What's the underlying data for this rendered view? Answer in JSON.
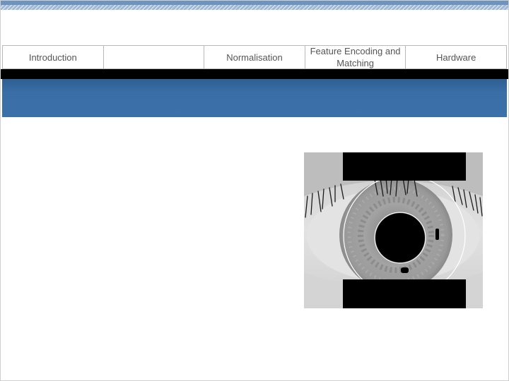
{
  "nav": {
    "items": [
      {
        "label": "Introduction"
      },
      {
        "label": ""
      },
      {
        "label": "Normalisation"
      },
      {
        "label": "Feature Encoding and Matching"
      },
      {
        "label": "Hardware"
      }
    ]
  },
  "figure": {
    "icon": "segmented-iris-eye-image",
    "colors": {
      "mask": "#000000",
      "boundary": "#ffffff",
      "sclera": "#d9d9d9",
      "iris": "#9c9c9c"
    }
  },
  "colors": {
    "accent": "#3a6ea7",
    "band": "#000000",
    "stripe": "#9fb8d6"
  }
}
